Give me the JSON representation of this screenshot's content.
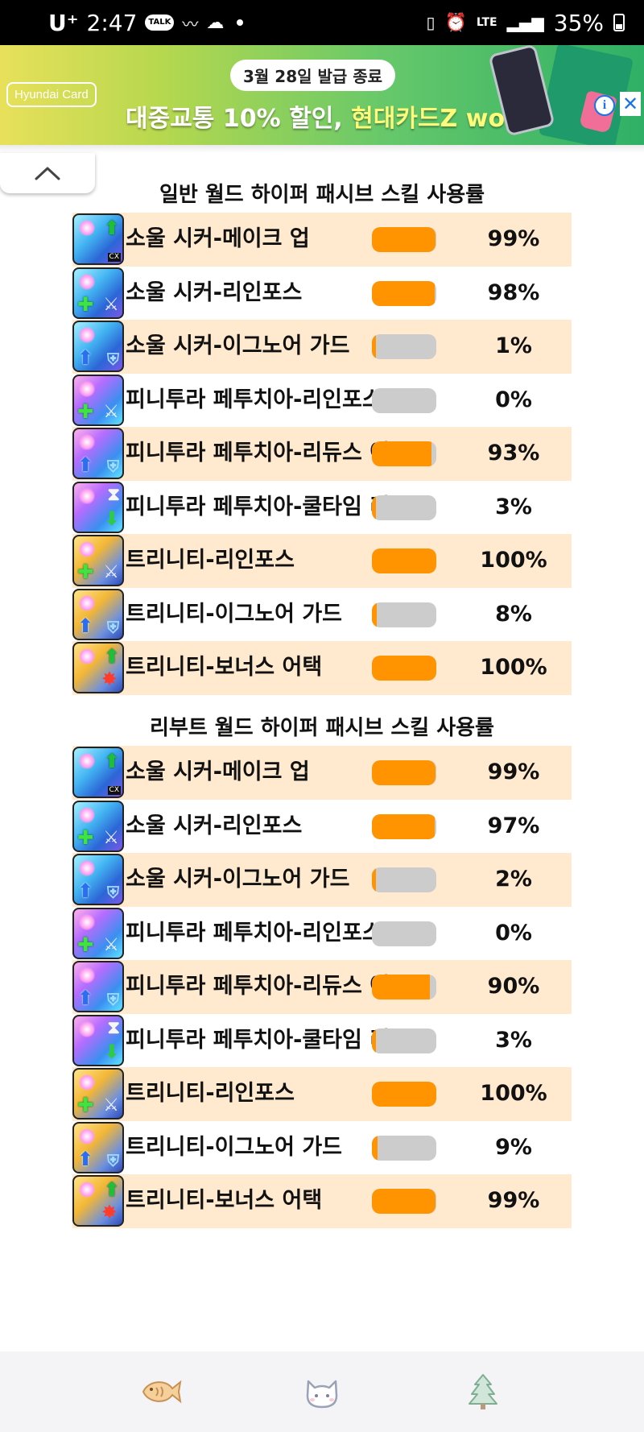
{
  "status_bar": {
    "carrier": "U⁺",
    "time": "2:47",
    "talk_badge": "TALK",
    "network": "LTE",
    "battery_percent": "35%"
  },
  "ad": {
    "brand": "Hyundai Card",
    "date_badge": "3월 28일 발급 종료",
    "headline_prefix": "대중교통 10% 할인, ",
    "headline_highlight": "현대카드Z work",
    "colors": {
      "bg_start": "#e8e05a",
      "bg_end": "#2fb066"
    }
  },
  "colors": {
    "row_highlight": "#ffe9cf",
    "bar_fill": "#ff9300",
    "bar_track": "#cccccc"
  },
  "sections": [
    {
      "title": "일반 월드 하이퍼 패시브 스킬 사용률",
      "rows": [
        {
          "icon": "soul-seeker-make-up-icon",
          "name": "소울 시커-메이크 업",
          "percent": "99%",
          "fill": 0.99
        },
        {
          "icon": "soul-seeker-reinforce-icon",
          "name": "소울 시커-리인포스",
          "percent": "98%",
          "fill": 0.98
        },
        {
          "icon": "soul-seeker-ignore-guard-icon",
          "name": "소울 시커-이그노어 가드",
          "percent": "1%",
          "fill": 0.01
        },
        {
          "icon": "pinnitura-reinforce-icon",
          "name": "피니투라 페투치아-리인포스",
          "percent": "0%",
          "fill": 0.0
        },
        {
          "icon": "pinnitura-reduce-icon",
          "name": "피니투라 페투치아-리듀스 어",
          "percent": "93%",
          "fill": 0.93
        },
        {
          "icon": "pinnitura-cooltime-icon",
          "name": "피니투라 페투치아-쿨타임 리",
          "percent": "3%",
          "fill": 0.03
        },
        {
          "icon": "trinity-reinforce-icon",
          "name": "트리니티-리인포스",
          "percent": "100%",
          "fill": 1.0
        },
        {
          "icon": "trinity-ignore-guard-icon",
          "name": "트리니티-이그노어 가드",
          "percent": "8%",
          "fill": 0.08
        },
        {
          "icon": "trinity-bonus-attack-icon",
          "name": "트리니티-보너스 어택",
          "percent": "100%",
          "fill": 1.0
        }
      ]
    },
    {
      "title": "리부트 월드 하이퍼 패시브 스킬 사용률",
      "rows": [
        {
          "icon": "soul-seeker-make-up-icon",
          "name": "소울 시커-메이크 업",
          "percent": "99%",
          "fill": 0.99
        },
        {
          "icon": "soul-seeker-reinforce-icon",
          "name": "소울 시커-리인포스",
          "percent": "97%",
          "fill": 0.97
        },
        {
          "icon": "soul-seeker-ignore-guard-icon",
          "name": "소울 시커-이그노어 가드",
          "percent": "2%",
          "fill": 0.02
        },
        {
          "icon": "pinnitura-reinforce-icon",
          "name": "피니투라 페투치아-리인포스",
          "percent": "0%",
          "fill": 0.0
        },
        {
          "icon": "pinnitura-reduce-icon",
          "name": "피니투라 페투치아-리듀스 어",
          "percent": "90%",
          "fill": 0.9
        },
        {
          "icon": "pinnitura-cooltime-icon",
          "name": "피니투라 페투치아-쿨타임 리",
          "percent": "3%",
          "fill": 0.03
        },
        {
          "icon": "trinity-reinforce-icon",
          "name": "트리니티-리인포스",
          "percent": "100%",
          "fill": 1.0
        },
        {
          "icon": "trinity-ignore-guard-icon",
          "name": "트리니티-이그노어 가드",
          "percent": "9%",
          "fill": 0.09
        },
        {
          "icon": "trinity-bonus-attack-icon",
          "name": "트리니티-보너스 어택",
          "percent": "99%",
          "fill": 0.99
        }
      ]
    }
  ],
  "bottom_nav": [
    {
      "icon": "fish-bread-icon"
    },
    {
      "icon": "cat-face-icon"
    },
    {
      "icon": "tree-icon"
    }
  ]
}
